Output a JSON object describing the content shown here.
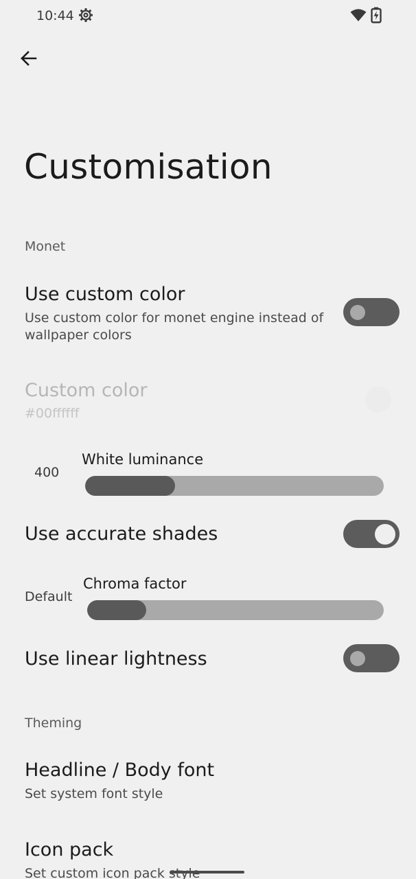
{
  "status_bar": {
    "time": "10:44",
    "icons": [
      "settings-gear-icon",
      "wifi-icon",
      "battery-charging-icon"
    ]
  },
  "header": {
    "back_icon": "arrow-back-icon",
    "title": "Customisation"
  },
  "monet": {
    "section_label": "Monet",
    "use_custom_color": {
      "title": "Use custom color",
      "summary": "Use custom color for monet engine instead of wallpaper colors",
      "enabled": false
    },
    "custom_color": {
      "title": "Custom color",
      "value": "#00ffffff",
      "disabled": true
    },
    "white_luminance": {
      "label": "White luminance",
      "value_text": "400",
      "fraction": 0.3
    },
    "use_accurate_shades": {
      "title": "Use accurate shades",
      "enabled": true
    },
    "chroma_factor": {
      "label": "Chroma factor",
      "value_text": "Default",
      "fraction": 0.2
    },
    "use_linear_lightness": {
      "title": "Use linear lightness",
      "enabled": false
    }
  },
  "theming": {
    "section_label": "Theming",
    "headline_body_font": {
      "title": "Headline / Body font",
      "summary": "Set system font style"
    },
    "icon_pack": {
      "title": "Icon pack",
      "summary": "Set custom icon pack style"
    }
  },
  "colors": {
    "background": "#f0f0f0",
    "switch_track": "#5c5c5c",
    "slider_fill": "#595959",
    "slider_track": "#a9a9a9"
  }
}
